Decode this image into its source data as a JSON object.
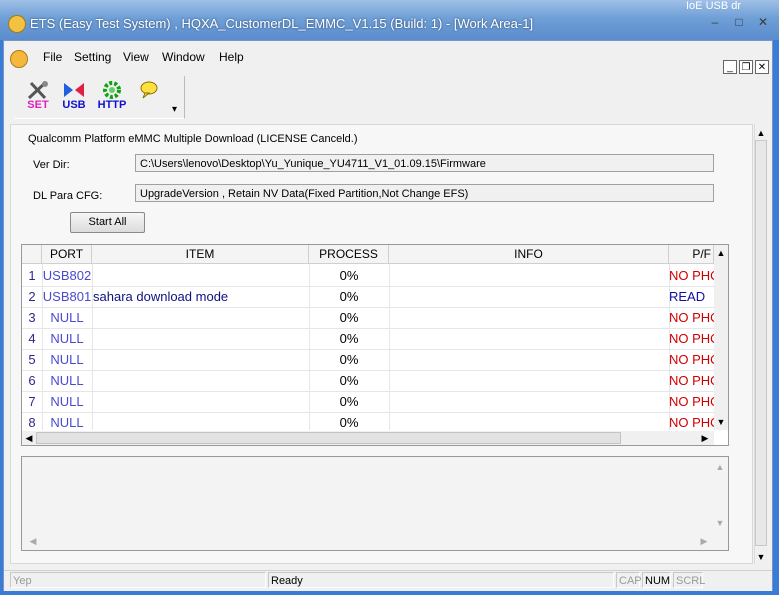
{
  "window": {
    "title": "ETS (Easy Test System) , HQXA_CustomerDL_EMMC_V1.15 (Build: 1) - [Work Area-1]",
    "edge_text": "IoE USB dr",
    "minimize_glyph": "–",
    "maximize_glyph": "□",
    "close_glyph": "✕"
  },
  "menubar": {
    "items": [
      "File",
      "Setting",
      "View",
      "Window",
      "Help"
    ],
    "mdi": {
      "minimize": "_",
      "restore": "❐",
      "close": "✕"
    }
  },
  "toolbar": {
    "buttons": [
      {
        "label": "SET",
        "icon": "set-tool-icon",
        "color": "#e020c0"
      },
      {
        "label": "USB",
        "icon": "usb-icon",
        "color": "#1010d0"
      },
      {
        "label": "HTTP",
        "icon": "http-gear-icon",
        "color": "#1010d0"
      },
      {
        "label": "",
        "icon": "chat-bubble-icon",
        "color": "#e0c000"
      }
    ],
    "overflow": "▾"
  },
  "panel": {
    "heading": "Qualcomm Platform eMMC Multiple Download (LICENSE Canceld.)",
    "ver_dir_label": "Ver Dir:",
    "ver_dir_value": "C:\\Users\\lenovo\\Desktop\\Yu_Yunique_YU4711_V1_01.09.15\\Firmware",
    "dl_para_label": "DL Para CFG:",
    "dl_para_value": "UpgradeVersion , Retain NV Data(Fixed Partition,Not Change EFS)",
    "start_button": "Start All"
  },
  "grid": {
    "columns": [
      "",
      "PORT",
      "ITEM",
      "PROCESS",
      "INFO",
      "P/F"
    ],
    "rows": [
      {
        "idx": "1",
        "port": "USB802",
        "item": "",
        "process": "0%",
        "info": "",
        "pf": "NO PHO"
      },
      {
        "idx": "2",
        "port": "USB801",
        "item": "sahara download mode",
        "process": "0%",
        "info": "",
        "pf": "READ"
      },
      {
        "idx": "3",
        "port": "NULL",
        "item": "",
        "process": "0%",
        "info": "",
        "pf": "NO PHO"
      },
      {
        "idx": "4",
        "port": "NULL",
        "item": "",
        "process": "0%",
        "info": "",
        "pf": "NO PHO"
      },
      {
        "idx": "5",
        "port": "NULL",
        "item": "",
        "process": "0%",
        "info": "",
        "pf": "NO PHO"
      },
      {
        "idx": "6",
        "port": "NULL",
        "item": "",
        "process": "0%",
        "info": "",
        "pf": "NO PHO"
      },
      {
        "idx": "7",
        "port": "NULL",
        "item": "",
        "process": "0%",
        "info": "",
        "pf": "NO PHO"
      },
      {
        "idx": "8",
        "port": "NULL",
        "item": "",
        "process": "0%",
        "info": "",
        "pf": "NO PHO"
      }
    ],
    "arrows": {
      "up": "▲",
      "down": "▼",
      "left": "◀",
      "right": "▶"
    }
  },
  "statusbar": {
    "left": "Yep",
    "middle": "Ready",
    "cap": "CAP",
    "num": "NUM",
    "scrl": "SCRL"
  },
  "colors": {
    "fail": "#d00000",
    "ready": "#1010a0",
    "port": "#4a4acf",
    "titlebar": "#6f9fd6"
  }
}
